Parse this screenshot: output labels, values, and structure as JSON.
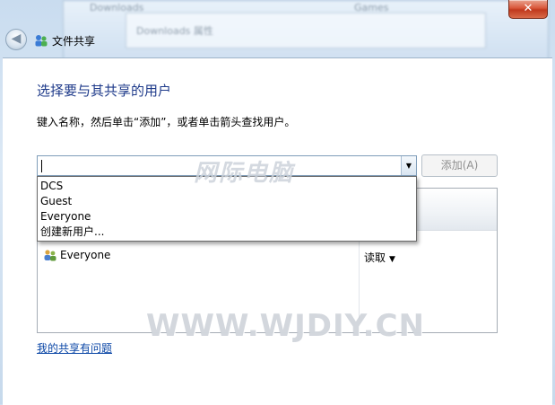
{
  "window": {
    "title": "文件共享",
    "close_glyph": "✕",
    "back_glyph": "◀"
  },
  "background": {
    "blur_text_1": "Downloads",
    "blur_text_2": "Downloads 属性",
    "blur_text_3": "Games"
  },
  "dialog": {
    "heading": "选择要与其共享的用户",
    "hint": "键入名称，然后单击“添加”，或者单击箭头查找用户。",
    "input_value": "",
    "combo_arrow_glyph": "▼",
    "add_button": "添加(A)",
    "help_link": "我的共享有问题"
  },
  "dropdown_items": [
    "DCS",
    "Guest",
    "Everyone",
    "创建新用户..."
  ],
  "share_list": {
    "rows": [
      {
        "name": "Everyone",
        "permission": "读取",
        "arrow": "▼"
      }
    ]
  },
  "watermarks": {
    "cn": "网际电脑",
    "url": "WWW.WJDIY.CN"
  },
  "colors": {
    "heading": "#1e3a8a",
    "link": "#0a46a6",
    "close": "#c0381c"
  }
}
